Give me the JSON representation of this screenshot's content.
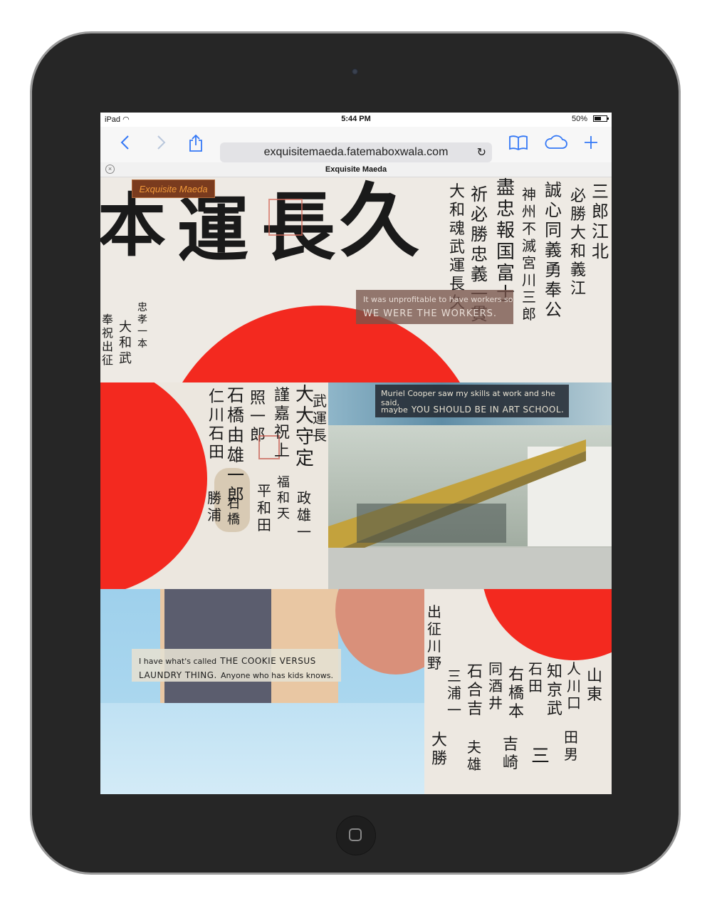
{
  "status": {
    "device": "iPad",
    "time": "5:44 PM",
    "battery": "50%",
    "battery_level": 0.5
  },
  "toolbar": {
    "url": "exquisitemaeda.fatemaboxwala.com"
  },
  "tab": {
    "title": "Exquisite Maeda"
  },
  "page": {
    "logo": "Exquisite Maeda",
    "caption1": {
      "line1": "It was unprofitable to have workers so",
      "line2": "WE WERE THE WORKERS."
    },
    "caption2": {
      "line1": "Muriel Cooper saw my skills at work and she said,",
      "line2a": "maybe",
      "line2b": "YOU SHOULD BE IN ART SCHOOL."
    },
    "caption3": {
      "line1a": "I have what's called",
      "line1b": "THE COOKIE VERSUS",
      "line2a": "LAUNDRY THING.",
      "line2b": "Anyone who has kids knows."
    }
  },
  "colors": {
    "flag_red": "#f3291f",
    "cloth": "#eeeae4",
    "ink": "#1a1a1a",
    "accent": "#3478f6"
  }
}
